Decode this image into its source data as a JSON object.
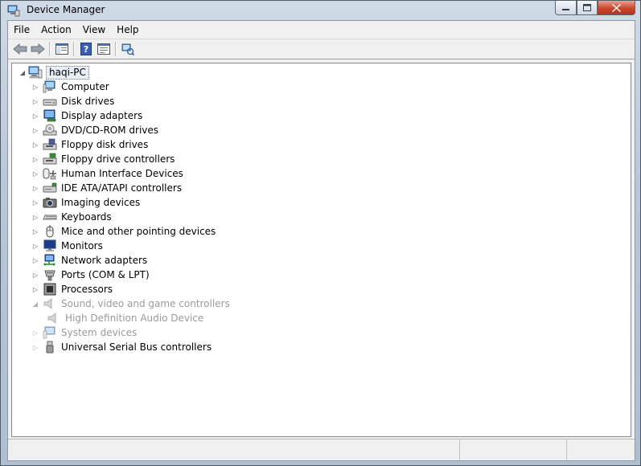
{
  "window": {
    "title": "Device Manager",
    "icon": "device-manager-icon",
    "controls": {
      "minimize": "minimize-icon",
      "maximize": "maximize-icon",
      "close": "close-icon"
    }
  },
  "menu": [
    "File",
    "Action",
    "View",
    "Help"
  ],
  "toolbar": [
    {
      "name": "back-button",
      "icon": "back-arrow-icon"
    },
    {
      "name": "forward-button",
      "icon": "forward-arrow-icon"
    },
    {
      "name": "show-hide-console-tree-button",
      "icon": "console-tree-icon"
    },
    {
      "name": "help-button",
      "icon": "help-icon"
    },
    {
      "name": "properties-button",
      "icon": "properties-icon"
    },
    {
      "name": "scan-hardware-button",
      "icon": "scan-hardware-icon"
    }
  ],
  "tree": {
    "root": {
      "label": "haqi-PC",
      "icon": "computer-icon",
      "expanded": true
    },
    "items": [
      {
        "label": "Computer",
        "icon": "computer-icon",
        "expanded": false,
        "disabled": false
      },
      {
        "label": "Disk drives",
        "icon": "disk-drive-icon",
        "expanded": false,
        "disabled": false
      },
      {
        "label": "Display adapters",
        "icon": "display-adapter-icon",
        "expanded": false,
        "disabled": false
      },
      {
        "label": "DVD/CD-ROM drives",
        "icon": "dvd-drive-icon",
        "expanded": false,
        "disabled": false
      },
      {
        "label": "Floppy disk drives",
        "icon": "floppy-disk-icon",
        "expanded": false,
        "disabled": false
      },
      {
        "label": "Floppy drive controllers",
        "icon": "floppy-controller-icon",
        "expanded": false,
        "disabled": false
      },
      {
        "label": "Human Interface Devices",
        "icon": "hid-icon",
        "expanded": false,
        "disabled": false
      },
      {
        "label": "IDE ATA/ATAPI controllers",
        "icon": "ide-controller-icon",
        "expanded": false,
        "disabled": false
      },
      {
        "label": "Imaging devices",
        "icon": "camera-icon",
        "expanded": false,
        "disabled": false
      },
      {
        "label": "Keyboards",
        "icon": "keyboard-icon",
        "expanded": false,
        "disabled": false
      },
      {
        "label": "Mice and other pointing devices",
        "icon": "mouse-icon",
        "expanded": false,
        "disabled": false
      },
      {
        "label": "Monitors",
        "icon": "monitor-icon",
        "expanded": false,
        "disabled": false
      },
      {
        "label": "Network adapters",
        "icon": "network-adapter-icon",
        "expanded": false,
        "disabled": false
      },
      {
        "label": "Ports (COM & LPT)",
        "icon": "port-icon",
        "expanded": false,
        "disabled": false
      },
      {
        "label": "Processors",
        "icon": "processor-icon",
        "expanded": false,
        "disabled": false
      },
      {
        "label": "Sound, video and game controllers",
        "icon": "speaker-icon",
        "expanded": true,
        "disabled": true
      },
      {
        "label": "High Definition Audio Device",
        "icon": "speaker-icon",
        "child": true,
        "disabled": true
      },
      {
        "label": "System devices",
        "icon": "system-device-icon",
        "expanded": false,
        "disabled": true
      },
      {
        "label": "Universal Serial Bus controllers",
        "icon": "usb-icon",
        "expanded": false,
        "disabled": false
      }
    ]
  },
  "statusbar": {
    "panes": [
      "",
      "",
      ""
    ]
  }
}
